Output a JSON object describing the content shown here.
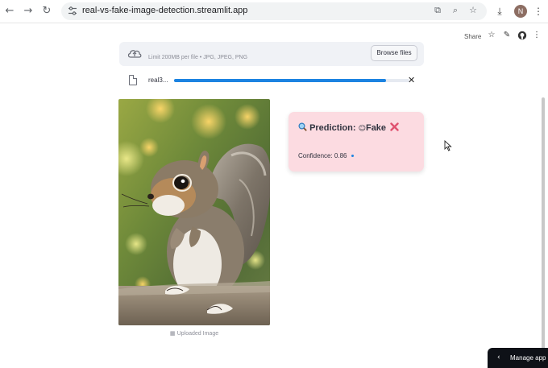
{
  "browser": {
    "url": "real-vs-fake-image-detection.streamlit.app",
    "avatar_letter": "N"
  },
  "header": {
    "share_label": "Share"
  },
  "uploader": {
    "limit_text": "Limit 200MB per file • JPG, JPEG, PNG",
    "browse_label": "Browse files",
    "file_name": "real3...",
    "progress": 0.9
  },
  "image": {
    "caption": "Uploaded Image"
  },
  "result": {
    "prediction_label": "Prediction:",
    "prediction_value": "Fake",
    "confidence_label": "Confidence: 0.86"
  },
  "manage_app": {
    "label": "Manage app"
  },
  "colors": {
    "accent": "#1c83e1",
    "result_bg": "#fcdbe1",
    "fake_mark": "#e05270"
  }
}
